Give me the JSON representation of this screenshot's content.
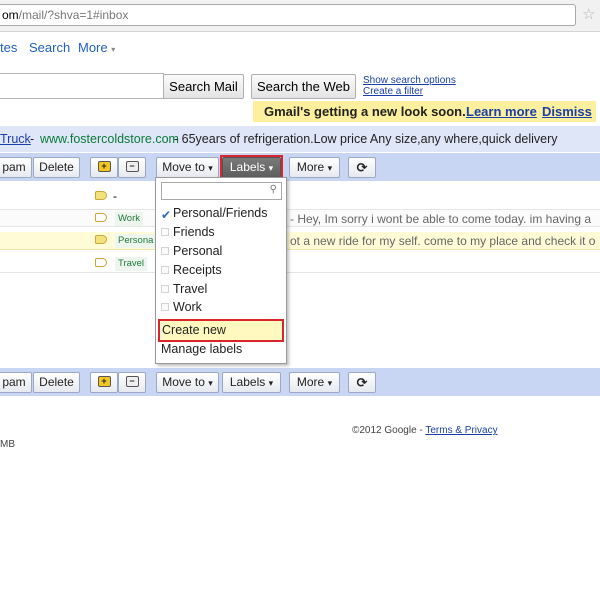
{
  "browser": {
    "url_host": "om",
    "url_path": "/mail/?shva=1#inbox",
    "star_icon": "star-outline-icon"
  },
  "nav": {
    "items": [
      {
        "label": "tes"
      },
      {
        "label": "Search"
      },
      {
        "label": "More"
      }
    ],
    "more_arrow": "▾"
  },
  "search": {
    "value": "",
    "search_mail_label": "Search Mail",
    "search_web_label": "Search the Web",
    "show_options_label": "Show search options",
    "create_filter_label": "Create a filter"
  },
  "notice": {
    "text": "Gmail's getting a new look soon.",
    "learn_more_label": "Learn more",
    "dismiss_label": "Dismiss"
  },
  "ad": {
    "title": "Truck",
    "url": "www.fostercoldstore.com",
    "separator": "-",
    "text": "- 65years of refrigeration.Low price Any size,any where,quick delivery"
  },
  "toolbar": {
    "spam_label": "pam",
    "delete_label": "Delete",
    "move_to_label": "Move to",
    "labels_label": "Labels",
    "more_label": "More",
    "dropdown_arrow": "▾",
    "refresh_icon": "refresh-icon"
  },
  "messages": [
    {
      "label": "",
      "snippet": "-",
      "tag": "yellow"
    },
    {
      "label": "Work",
      "snippet": "- Hey, Im sorry i wont be able to come today. im having a",
      "tag": "outline"
    },
    {
      "label": "Persona",
      "snippet": "ot a new ride for my self. come to my place and check it o",
      "tag": "yellow"
    },
    {
      "label": "Travel",
      "snippet": "",
      "tag": "outline"
    }
  ],
  "labels_menu": {
    "search_value": "",
    "items": [
      {
        "label": "Personal/Friends",
        "checked": true
      },
      {
        "label": "Friends",
        "checked": false
      },
      {
        "label": "Personal",
        "checked": false
      },
      {
        "label": "Receipts",
        "checked": false
      },
      {
        "label": "Travel",
        "checked": false
      },
      {
        "label": "Work",
        "checked": false
      }
    ],
    "create_new_label": "Create new",
    "manage_labels_label": "Manage labels",
    "check_mark": "✔"
  },
  "footer": {
    "copyright": "©2012 Google -",
    "terms_label": "Terms & Privacy",
    "usage_text": "MB"
  },
  "colors": {
    "toolbar_bg": "#c9d6f3",
    "highlight_red": "#d9262c",
    "notice_yellow": "#fcef9d",
    "link_blue": "#1a3fa8"
  }
}
